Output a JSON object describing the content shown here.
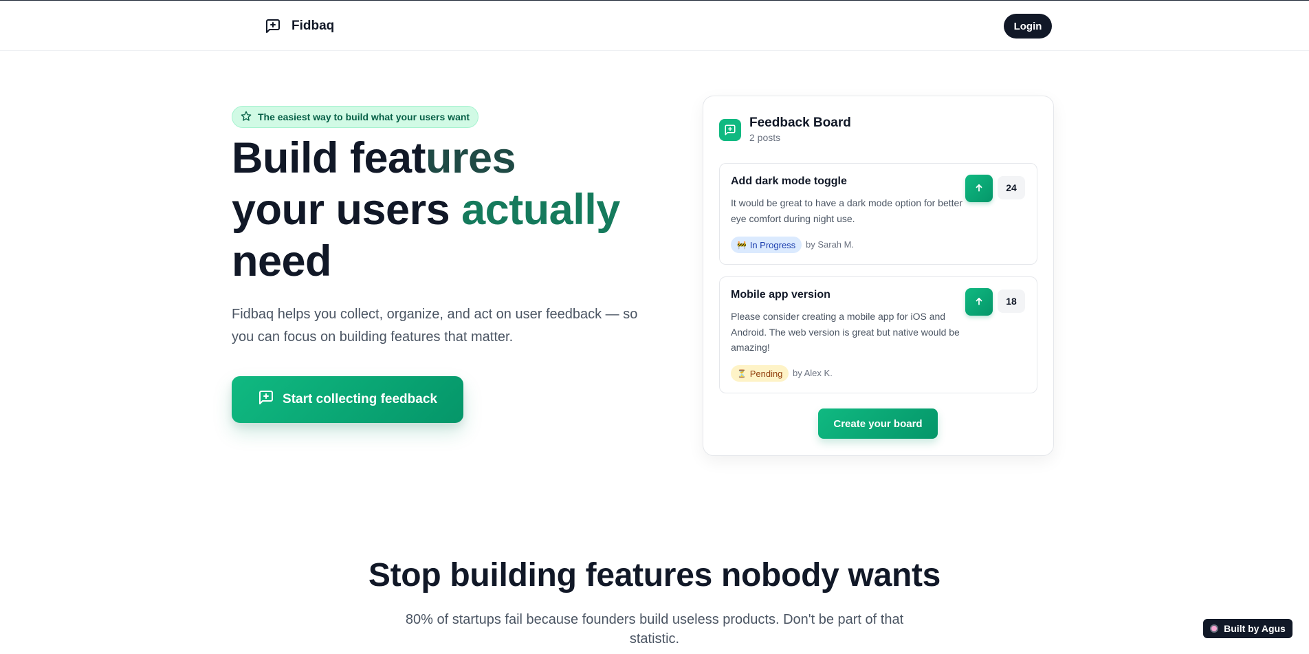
{
  "header": {
    "brand": "Fidbaq",
    "login_label": "Login"
  },
  "hero": {
    "badge": "The easiest way to build what your users want",
    "title_line1_a": "Build feat",
    "title_line1_b": "ures",
    "title_line2_a": "your users ",
    "title_line2_b": "actually",
    "title_line3": "need",
    "subtitle": "Fidbaq helps you collect, organize, and act on user feedback — so you can focus on building features that matter.",
    "cta_label": "Start collecting feedback"
  },
  "board": {
    "title": "Feedback Board",
    "count": "2 posts",
    "posts": [
      {
        "title": "Add dark mode toggle",
        "description": "It would be great to have a dark mode option for better eye comfort during night use.",
        "votes": "24",
        "status": "In Progress",
        "status_icon": "🚧",
        "author": "by Sarah M."
      },
      {
        "title": "Mobile app version",
        "description": "Please consider creating a mobile app for iOS and Android. The web version is great but native would be amazing!",
        "votes": "18",
        "status": "Pending",
        "status_icon": "⏳",
        "author": "by Alex K."
      }
    ],
    "create_label": "Create your board"
  },
  "section2": {
    "title": "Stop building features nobody wants",
    "subtitle": "80% of startups fail because founders build useless products. Don't be part of that statistic."
  },
  "built_by": "Built by Agus",
  "colors": {
    "accent": "#10b981",
    "accent_dark": "#059669",
    "dark": "#111827"
  }
}
